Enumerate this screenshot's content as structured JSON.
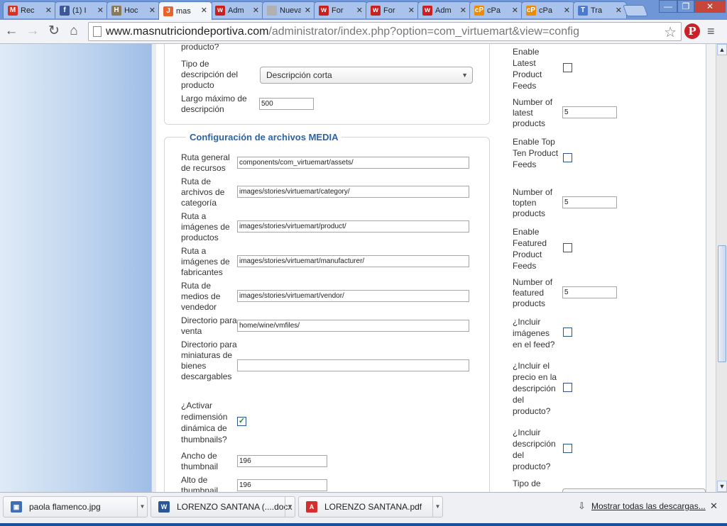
{
  "browser": {
    "tabs": [
      {
        "label": "Rec",
        "icon": "gmail-icon",
        "color": "#d93025",
        "glyph": "M"
      },
      {
        "label": "(1) I",
        "icon": "facebook-icon",
        "color": "#3b5998",
        "glyph": "f"
      },
      {
        "label": "Hoc",
        "icon": "avatar-icon",
        "color": "#8a7a55",
        "glyph": "H"
      },
      {
        "label": "mas",
        "icon": "joomla-icon",
        "color": "#e8642c",
        "glyph": "J",
        "active": true
      },
      {
        "label": "Adm",
        "icon": "wolf-icon",
        "color": "#cc1f1f",
        "glyph": "w"
      },
      {
        "label": "Nueva",
        "icon": "blank-icon",
        "color": "#b0b0b0",
        "glyph": ""
      },
      {
        "label": "For",
        "icon": "wolf-icon",
        "color": "#cc1f1f",
        "glyph": "w"
      },
      {
        "label": "For",
        "icon": "wolf-icon",
        "color": "#cc1f1f",
        "glyph": "w"
      },
      {
        "label": "Adm",
        "icon": "wolf-icon",
        "color": "#cc1f1f",
        "glyph": "w"
      },
      {
        "label": "cPa",
        "icon": "cpanel-icon",
        "color": "#f08a00",
        "glyph": "cP"
      },
      {
        "label": "cPa",
        "icon": "cpanel-icon",
        "color": "#f08a00",
        "glyph": "cP"
      },
      {
        "label": "Tra",
        "icon": "translate-icon",
        "color": "#4a7bd0",
        "glyph": "T"
      }
    ],
    "url_host": "www.masnutriciondeportiva.com",
    "url_path": "/administrator/index.php?option=com_virtuemart&view=config"
  },
  "left_form": {
    "top_label_fragment": "producto?",
    "description_type": {
      "label": "Tipo de descripción del producto",
      "selected": "Descripción corta"
    },
    "max_length": {
      "label": "Largo máximo de descripción",
      "value": "500"
    },
    "media_section_title": "Configuración de archivos MEDIA",
    "media_fields": [
      {
        "label": "Ruta general de recursos",
        "value": "components/com_virtuemart/assets/"
      },
      {
        "label": "Ruta de archivos de categoría",
        "value": "images/stories/virtuemart/category/"
      },
      {
        "label": "Ruta a imágenes de productos",
        "value": "images/stories/virtuemart/product/"
      },
      {
        "label": "Ruta a imágenes de fabricantes",
        "value": "images/stories/virtuemart/manufacturer/"
      },
      {
        "label": "Ruta de medios de vendedor",
        "value": "images/stories/virtuemart/vendor/"
      },
      {
        "label": "Directorio para venta",
        "value": "home/wine/vmfiles/"
      },
      {
        "label": "Directorio para miniaturas de bienes descargables",
        "value": ""
      }
    ],
    "dynamic_thumbnails": {
      "label": "¿Activar redimensión dinámica de thumbnails?",
      "checked": true
    },
    "thumb_width": {
      "label": "Ancho de thumbnail",
      "value": "196"
    },
    "thumb_height": {
      "label": "Alto de thumbnail",
      "value": "196"
    }
  },
  "right_form": {
    "enable_latest": {
      "label": "Enable Latest Product Feeds",
      "checked": false
    },
    "latest_count": {
      "label": "Number of latest products",
      "value": "5"
    },
    "enable_topten": {
      "label": "Enable Top Ten Product Feeds",
      "checked": false
    },
    "topten_count": {
      "label": "Number of topten products",
      "value": "5"
    },
    "enable_featured": {
      "label": "Enable Featured Product Feeds",
      "checked": false
    },
    "featured_count": {
      "label": "Number of featured products",
      "value": "5"
    },
    "include_images": {
      "label": "¿Incluir imágenes en el feed?",
      "checked": false
    },
    "include_price": {
      "label": "¿Incluir el precio en la descripción del producto?",
      "checked": false
    },
    "include_description": {
      "label": "¿Incluir descripción del producto?",
      "checked": false
    },
    "description_type_fragment": "Tipo de"
  },
  "downloads": {
    "items": [
      {
        "name": "paola flamenco.jpg",
        "icon": "image-file-icon",
        "color": "#3c6fb5",
        "glyph": "▣"
      },
      {
        "name": "LORENZO SANTANA (....docx",
        "icon": "word-file-icon",
        "color": "#2b5797",
        "glyph": "W"
      },
      {
        "name": "LORENZO SANTANA.pdf",
        "icon": "pdf-file-icon",
        "color": "#d32f2f",
        "glyph": "A"
      }
    ],
    "show_all": "Mostrar todas las descargas..."
  }
}
